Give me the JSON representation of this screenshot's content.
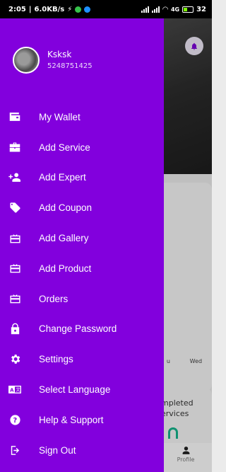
{
  "status_bar": {
    "time": "2:05",
    "network_speed": "6.0KB/s",
    "signal_text": "4G",
    "battery_percent": "32"
  },
  "background": {
    "notification_icon": "bell-icon",
    "weekdays": [
      "u",
      "Wed"
    ],
    "card_text": "mpleted ervices",
    "nav_profile_label": "Profile"
  },
  "user": {
    "name": "Ksksk",
    "phone": "5248751425"
  },
  "menu": [
    {
      "label": "My Wallet",
      "icon": "wallet-icon"
    },
    {
      "label": "Add Service",
      "icon": "toolbox-icon"
    },
    {
      "label": "Add Expert",
      "icon": "person-add-icon"
    },
    {
      "label": "Add Coupon",
      "icon": "tag-icon"
    },
    {
      "label": "Add Gallery",
      "icon": "gift-card-icon"
    },
    {
      "label": "Add Product",
      "icon": "gift-card-icon"
    },
    {
      "label": "Orders",
      "icon": "gift-card-icon"
    },
    {
      "label": "Change Password",
      "icon": "lock-icon"
    },
    {
      "label": "Settings",
      "icon": "gear-icon"
    },
    {
      "label": "Select Language",
      "icon": "translate-icon"
    },
    {
      "label": "Help & Support",
      "icon": "help-icon"
    },
    {
      "label": "Sign Out",
      "icon": "logout-icon"
    }
  ],
  "colors": {
    "drawer_background": "#8200dd",
    "text": "#ffffff",
    "accent_green": "#14b38a"
  }
}
